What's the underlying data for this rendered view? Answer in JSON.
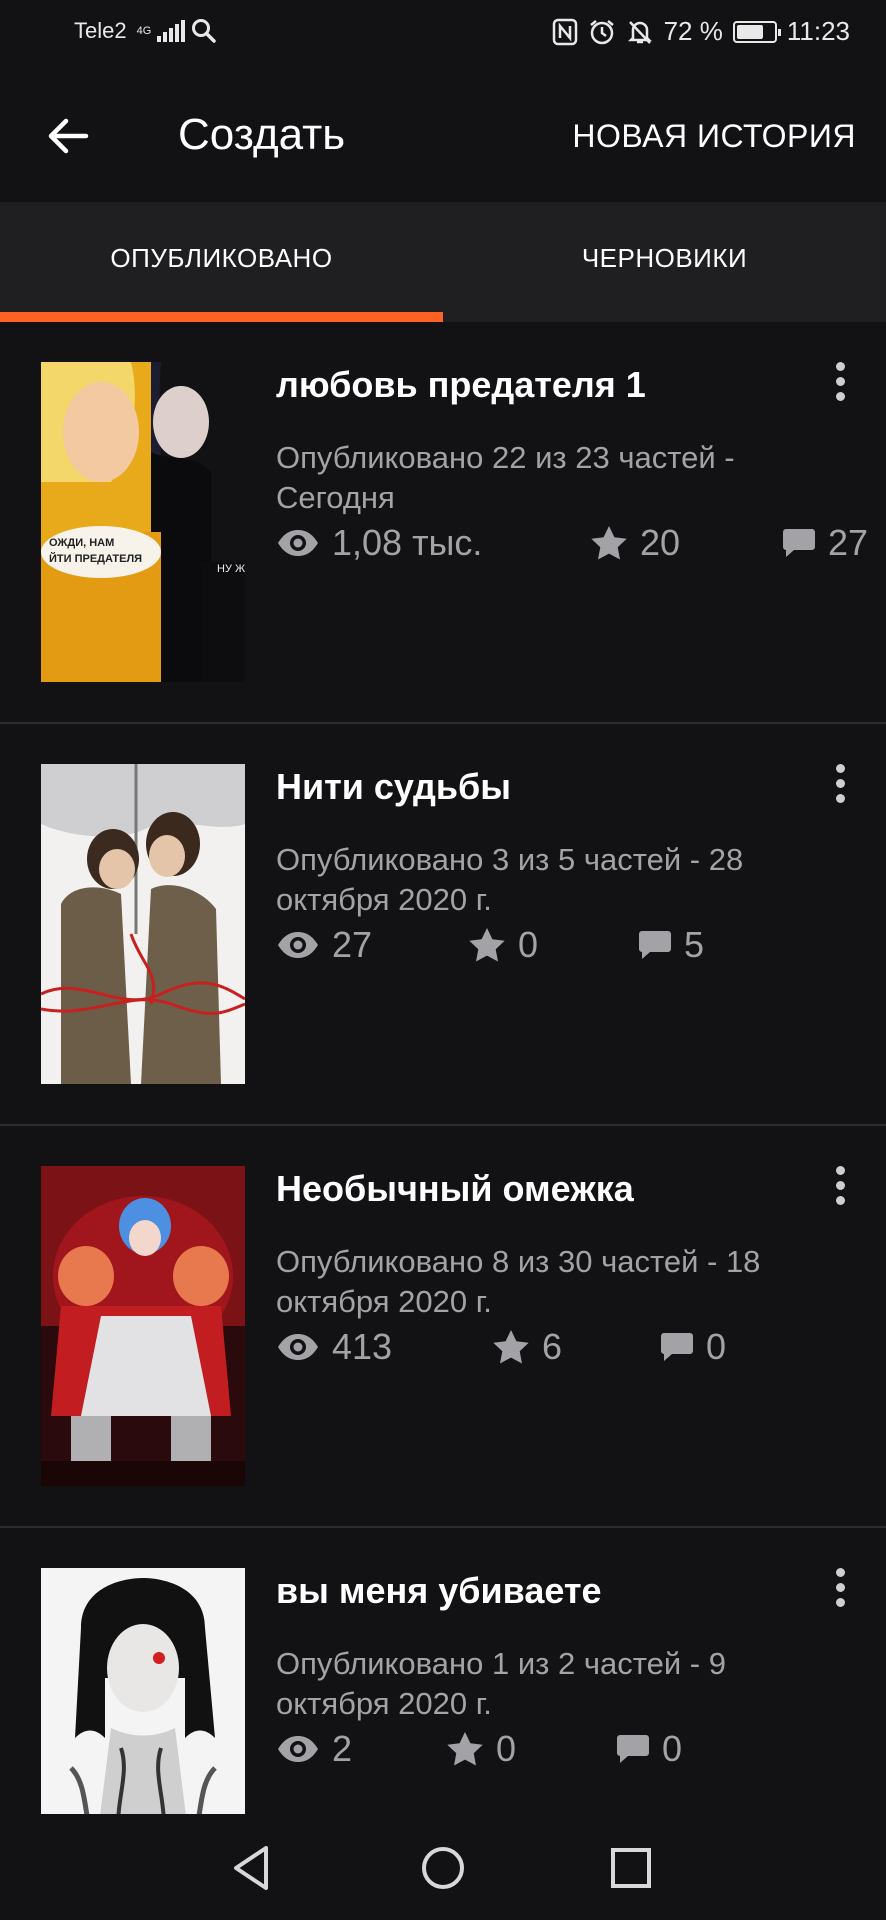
{
  "status_bar": {
    "carrier": "Tele2",
    "network": "4G",
    "battery": "72 %",
    "battery_level": 0.72,
    "time": "11:23"
  },
  "app_bar": {
    "title": "Создать",
    "action": "НОВАЯ ИСТОРИЯ"
  },
  "tabs": [
    {
      "label": "ОПУБЛИКОВАНО",
      "active": true
    },
    {
      "label": "ЧЕРНОВИКИ",
      "active": false
    }
  ],
  "accent_color": "#ff6122",
  "stories": [
    {
      "title": "любовь предателя 1",
      "meta": "Опубликовано 22 из 23 частей - Сегодня",
      "reads": "1,08 тыс.",
      "votes": "20",
      "comments": "27",
      "cover_text": [
        "ОЖДИ, НАМ",
        "ЙТИ ПРЕДАТЕЛЯ",
        "НУ Ж"
      ]
    },
    {
      "title": "Нити судьбы",
      "meta": "Опубликовано 3 из 5 частей - 28 октября 2020 г.",
      "reads": "27",
      "votes": "0",
      "comments": "5"
    },
    {
      "title": "Необычный омежка",
      "meta": "Опубликовано 8 из 30 частей - 18 октября 2020 г.",
      "reads": "413",
      "votes": "6",
      "comments": "0"
    },
    {
      "title": "вы меня убиваете",
      "meta": "Опубликовано 1 из 2 частей - 9 октября 2020 г.",
      "reads": "2",
      "votes": "0",
      "comments": "0"
    }
  ],
  "icons": {
    "reads": "eye-icon",
    "votes": "star-icon",
    "comments": "comment-icon",
    "menu": "more-vertical-icon"
  }
}
